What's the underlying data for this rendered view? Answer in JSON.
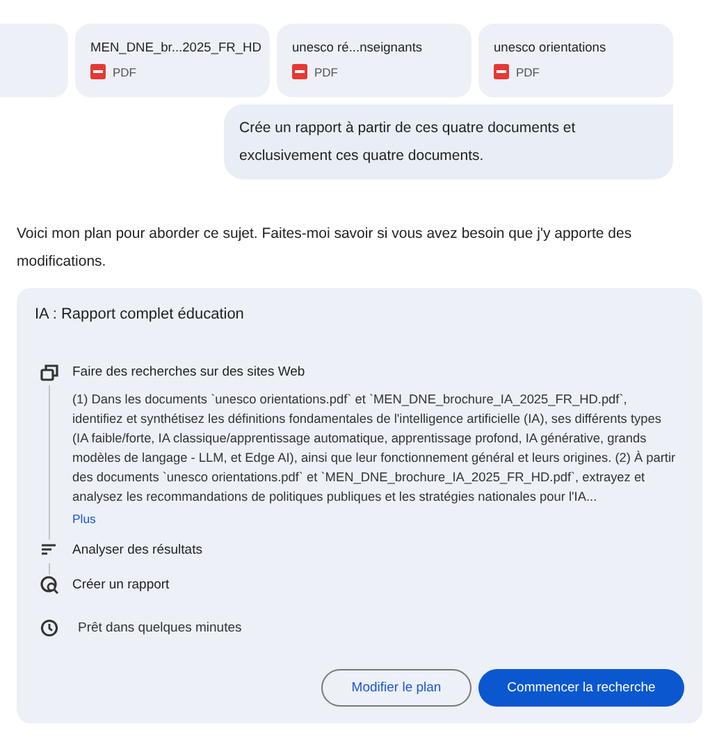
{
  "attachments": [
    {
      "kind": "partial"
    },
    {
      "kind": "file",
      "name": "MEN_DNE_br...2025_FR_HD",
      "type": "PDF"
    },
    {
      "kind": "file",
      "name": "unesco ré...nseignants",
      "type": "PDF"
    },
    {
      "kind": "file",
      "name": "unesco orientations",
      "type": "PDF"
    }
  ],
  "user_message": "Crée un rapport à partir de ces quatre documents et exclusivement ces quatre documents.",
  "reply": "Voici mon plan pour aborder ce sujet. Faites-moi savoir si vous avez besoin que j'y apporte des modifications.",
  "plan": {
    "title": "IA : Rapport complet éducation",
    "steps": [
      {
        "kind": "web",
        "label": "Faire des recherches sur des sites Web",
        "detail": "(1) Dans les documents `unesco orientations.pdf` et `MEN_DNE_brochure_IA_2025_FR_HD.pdf`, identifiez et synthétisez les définitions fondamentales de l'intelligence artificielle (IA), ses différents types (IA faible/forte, IA classique/apprentissage automatique, apprentissage profond, IA générative, grands modèles de langage - LLM, et Edge AI), ainsi que leur fonctionnement général et leurs origines. (2) À partir des documents `unesco orientations.pdf` et `MEN_DNE_brochure_IA_2025_FR_HD.pdf`, extrayez et analysez les recommandations de politiques publiques et les stratégies nationales pour l'IA...",
        "more": "Plus"
      },
      {
        "kind": "analyze",
        "label": "Analyser des résultats"
      },
      {
        "kind": "report",
        "label": "Créer un rapport"
      }
    ],
    "eta": "Prêt dans quelques minutes",
    "buttons": [
      {
        "label": "Modifier le plan",
        "kind": "outline"
      },
      {
        "label": "Commencer la recherche",
        "kind": "primary"
      }
    ]
  }
}
